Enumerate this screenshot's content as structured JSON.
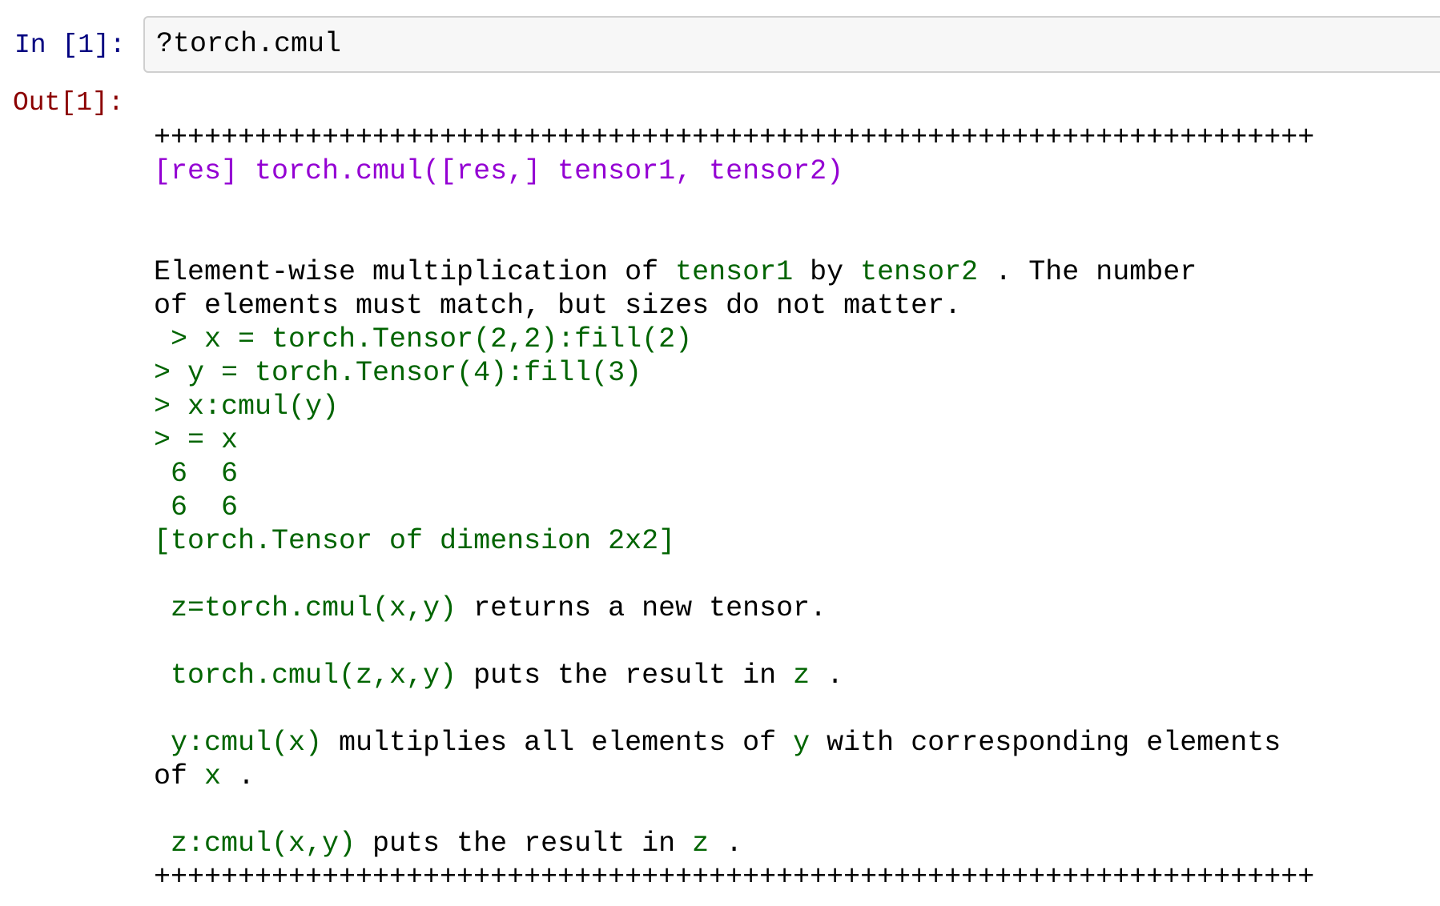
{
  "colors": {
    "plain": "#000000",
    "green": "#006400",
    "purple": "#9400d3",
    "in_prompt": "#000080",
    "out_prompt": "#8b0000"
  },
  "cell": {
    "in_prompt": "In [1]:",
    "input": "?torch.cmul",
    "out_prompt": "Out[1]:"
  },
  "output_lines": [
    [
      {
        "t": "+++++++++++++++++++++++++++++++++++++++++++++++++++++++++++++++++++++",
        "c": "plain"
      }
    ],
    [
      {
        "t": "[res] torch.cmul([res,] tensor1, tensor2)",
        "c": "purple"
      }
    ],
    [],
    [],
    [
      {
        "t": "Element-wise multiplication of ",
        "c": "plain"
      },
      {
        "t": "tensor1",
        "c": "green"
      },
      {
        "t": " by ",
        "c": "plain"
      },
      {
        "t": "tensor2",
        "c": "green"
      },
      {
        "t": " . The number",
        "c": "plain"
      }
    ],
    [
      {
        "t": "of elements must match, but sizes do not matter.",
        "c": "plain"
      }
    ],
    [
      {
        "t": " > x = torch.Tensor(2,2):fill(2)",
        "c": "green"
      }
    ],
    [
      {
        "t": "> y = torch.Tensor(4):fill(3)",
        "c": "green"
      }
    ],
    [
      {
        "t": "> x:cmul(y)",
        "c": "green"
      }
    ],
    [
      {
        "t": "> = x",
        "c": "green"
      }
    ],
    [
      {
        "t": " 6  6",
        "c": "green"
      }
    ],
    [
      {
        "t": " 6  6",
        "c": "green"
      }
    ],
    [
      {
        "t": "[torch.Tensor of dimension 2x2]",
        "c": "green"
      }
    ],
    [],
    [
      {
        "t": " z=torch.cmul(x,y)",
        "c": "green"
      },
      {
        "t": " returns a new tensor.",
        "c": "plain"
      }
    ],
    [],
    [
      {
        "t": " torch.cmul(z,x,y)",
        "c": "green"
      },
      {
        "t": " puts the result in ",
        "c": "plain"
      },
      {
        "t": "z",
        "c": "green"
      },
      {
        "t": " .",
        "c": "plain"
      }
    ],
    [],
    [
      {
        "t": " y:cmul(x)",
        "c": "green"
      },
      {
        "t": " multiplies all elements of ",
        "c": "plain"
      },
      {
        "t": "y",
        "c": "green"
      },
      {
        "t": " with corresponding elements",
        "c": "plain"
      }
    ],
    [
      {
        "t": "of ",
        "c": "plain"
      },
      {
        "t": "x",
        "c": "green"
      },
      {
        "t": " .",
        "c": "plain"
      }
    ],
    [],
    [
      {
        "t": " z:cmul(x,y)",
        "c": "green"
      },
      {
        "t": " puts the result in ",
        "c": "plain"
      },
      {
        "t": "z",
        "c": "green"
      },
      {
        "t": " .",
        "c": "plain"
      }
    ],
    [
      {
        "t": "+++++++++++++++++++++++++++++++++++++++++++++++++++++++++++++++++++++",
        "c": "plain"
      }
    ]
  ]
}
